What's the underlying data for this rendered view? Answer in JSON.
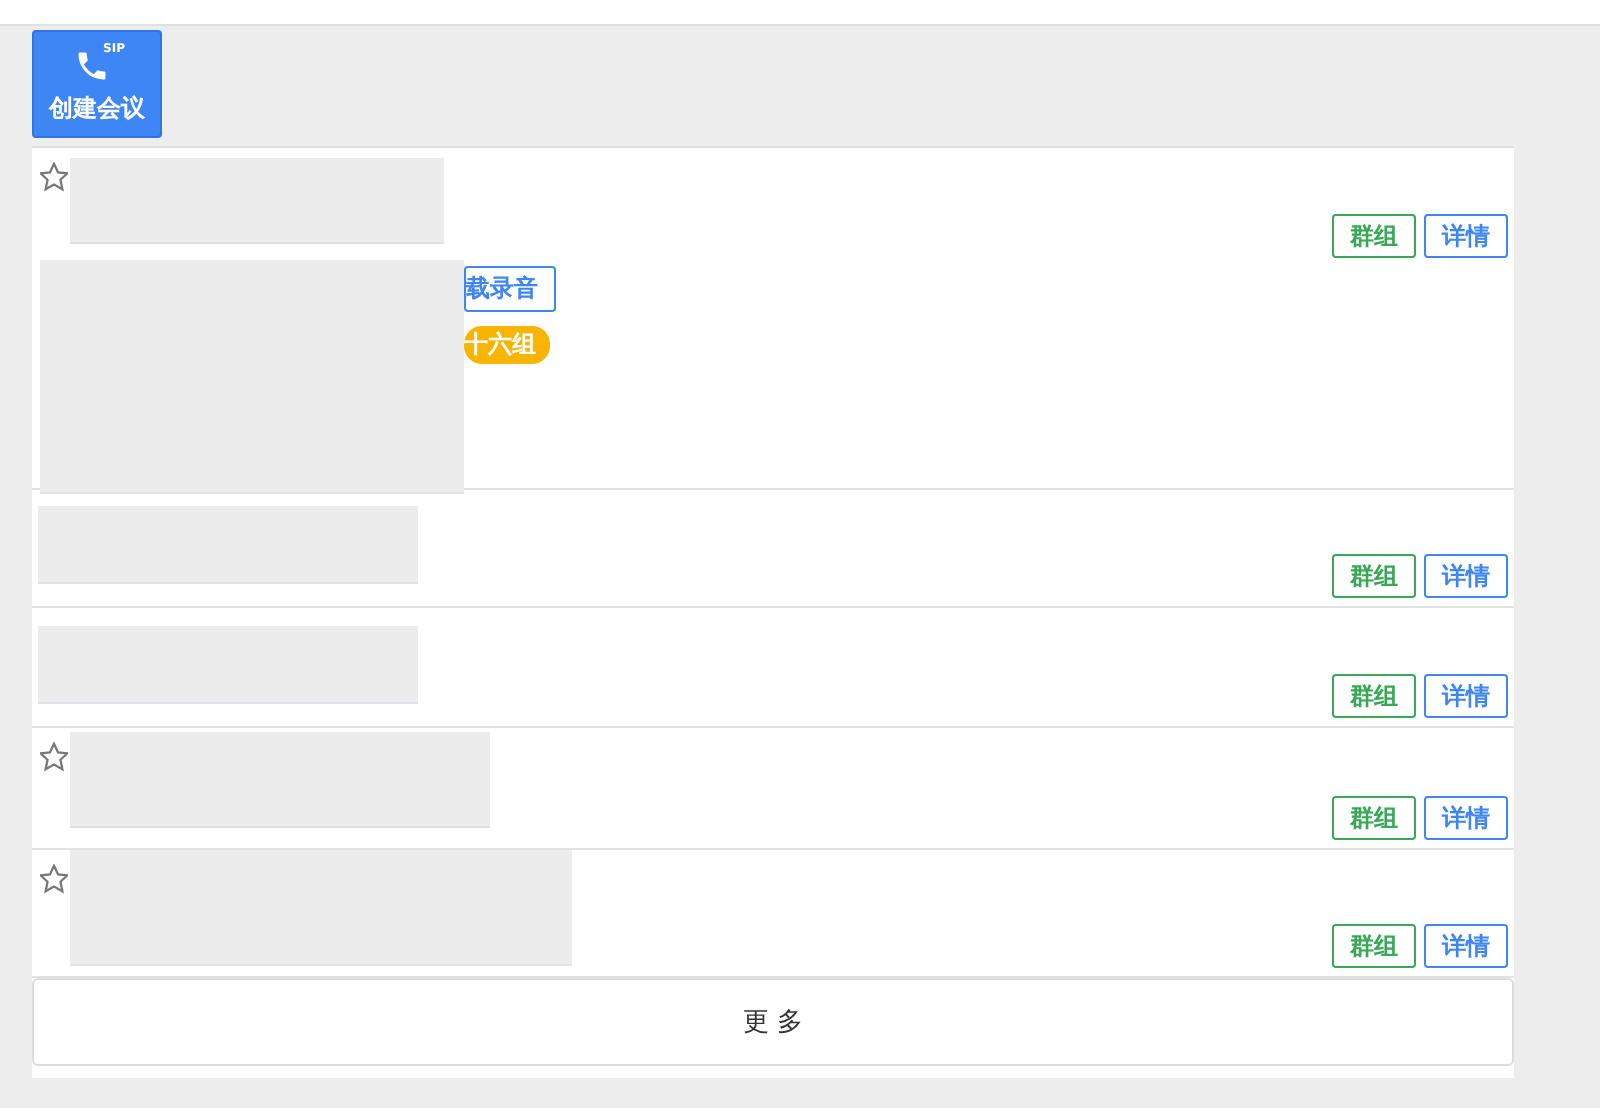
{
  "toolbar": {
    "create_button": {
      "label": "创建会议",
      "badge": "SIP"
    }
  },
  "rows": [
    {
      "kind": "expanded",
      "favorited": false,
      "download_label": "载录音",
      "tag": "十六组",
      "actions": [
        {
          "label": "群组",
          "kind": "group"
        },
        {
          "label": "详情",
          "kind": "detail"
        }
      ]
    },
    {
      "kind": "compact",
      "actions": [
        {
          "label": "群组",
          "kind": "group"
        },
        {
          "label": "详情",
          "kind": "detail"
        }
      ]
    },
    {
      "kind": "compact",
      "actions": [
        {
          "label": "群组",
          "kind": "group"
        },
        {
          "label": "详情",
          "kind": "detail"
        }
      ]
    },
    {
      "kind": "compact",
      "favorited": false,
      "actions": [
        {
          "label": "群组",
          "kind": "group"
        },
        {
          "label": "详情",
          "kind": "detail"
        }
      ]
    },
    {
      "kind": "compact",
      "favorited": false,
      "actions": [
        {
          "label": "群组",
          "kind": "group"
        },
        {
          "label": "详情",
          "kind": "detail"
        }
      ]
    }
  ],
  "more_label": "更 多"
}
